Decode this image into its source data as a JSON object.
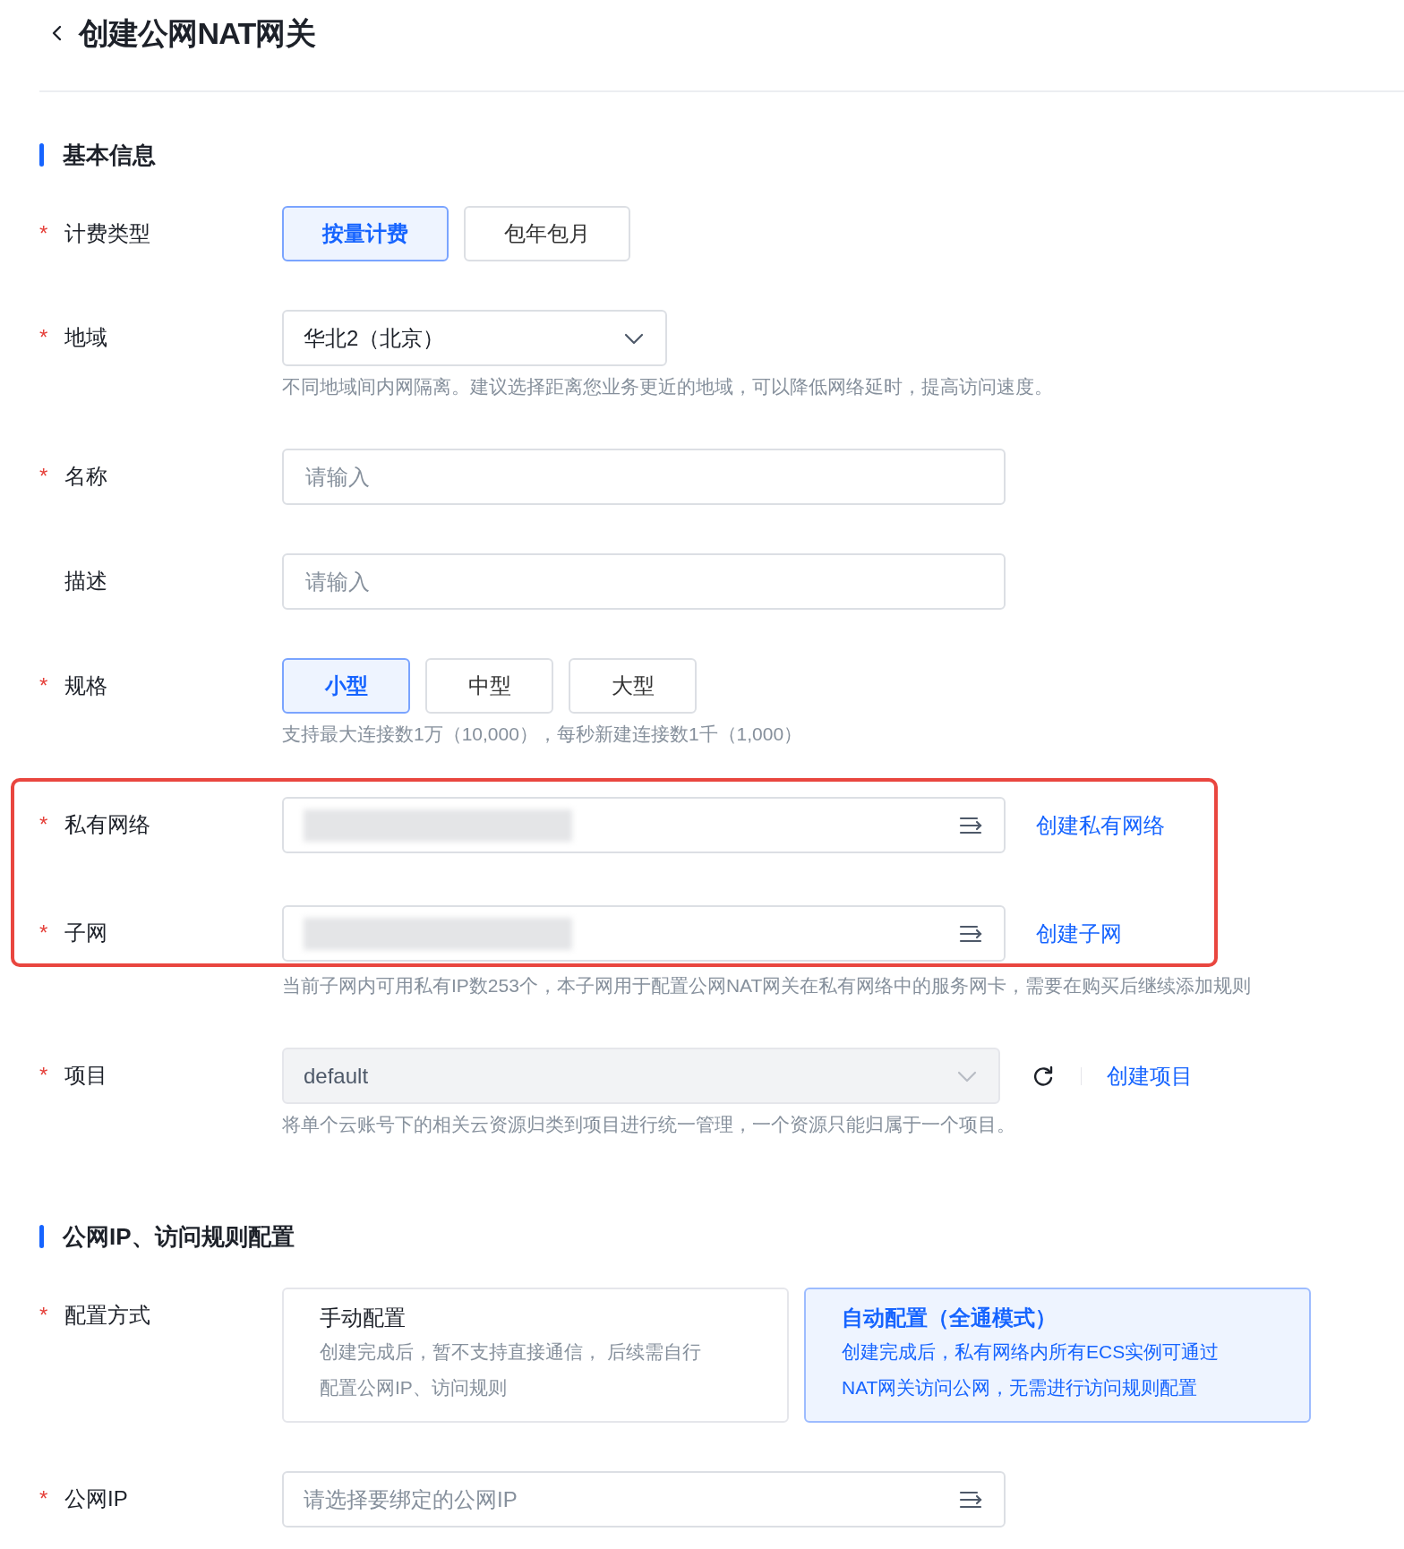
{
  "page": {
    "title": "创建公网NAT网关"
  },
  "sections": [
    {
      "title": "基本信息",
      "fields": [
        {
          "kind": "options",
          "label": "计费类型",
          "required_mark": "*",
          "options": [
            {
              "label": "按量计费",
              "selected": true
            },
            {
              "label": "包年包月",
              "selected": false
            }
          ]
        },
        {
          "kind": "dropdown",
          "label": "地域",
          "required_mark": "*",
          "value": "华北2（北京）",
          "disabled": false,
          "help": "不同地域间内网隔离。建议选择距离您业务更近的地域，可以降低网络延时，提高访问速度。"
        },
        {
          "kind": "input",
          "label": "名称",
          "required_mark": "*",
          "placeholder": "请输入"
        },
        {
          "kind": "input",
          "label": "描述",
          "placeholder": "请输入"
        },
        {
          "kind": "options",
          "label": "规格",
          "required_mark": "*",
          "options": [
            {
              "label": "小型",
              "selected": true
            },
            {
              "label": "中型",
              "selected": false
            },
            {
              "label": "大型",
              "selected": false
            }
          ],
          "help": "支持最大连接数1万（10,000），每秒新建连接数1千（1,000）"
        },
        {
          "kind": "picker",
          "label": "私有网络",
          "required_mark": "*",
          "redacted": true,
          "link": "创建私有网络",
          "highlighted": true
        },
        {
          "kind": "picker",
          "label": "子网",
          "required_mark": "*",
          "redacted": true,
          "link": "创建子网",
          "highlighted": true,
          "help": "当前子网内可用私有IP数253个，本子网用于配置公网NAT网关在私有网络中的服务网卡，需要在购买后继续添加规则"
        },
        {
          "kind": "dropdown",
          "label": "项目",
          "required_mark": "*",
          "value": "default",
          "disabled": true,
          "refresh": true,
          "link": "创建项目",
          "help": "将单个云账号下的相关云资源归类到项目进行统一管理，一个资源只能归属于一个项目。"
        }
      ]
    },
    {
      "title": "公网IP、访问规则配置",
      "fields": [
        {
          "kind": "cards",
          "label": "配置方式",
          "required_mark": "*",
          "options": [
            {
              "title": "手动配置",
              "description": "创建完成后，暂不支持直接通信， 后续需自行配置公网IP、访问规则",
              "selected": false
            },
            {
              "title": "自动配置（全通模式）",
              "description": "创建完成后，私有网络内所有ECS实例可通过NAT网关访问公网，无需进行访问规则配置",
              "selected": true
            }
          ]
        },
        {
          "kind": "picker",
          "label": "公网IP",
          "required_mark": "*",
          "placeholder": "请选择要绑定的公网IP"
        }
      ]
    }
  ]
}
